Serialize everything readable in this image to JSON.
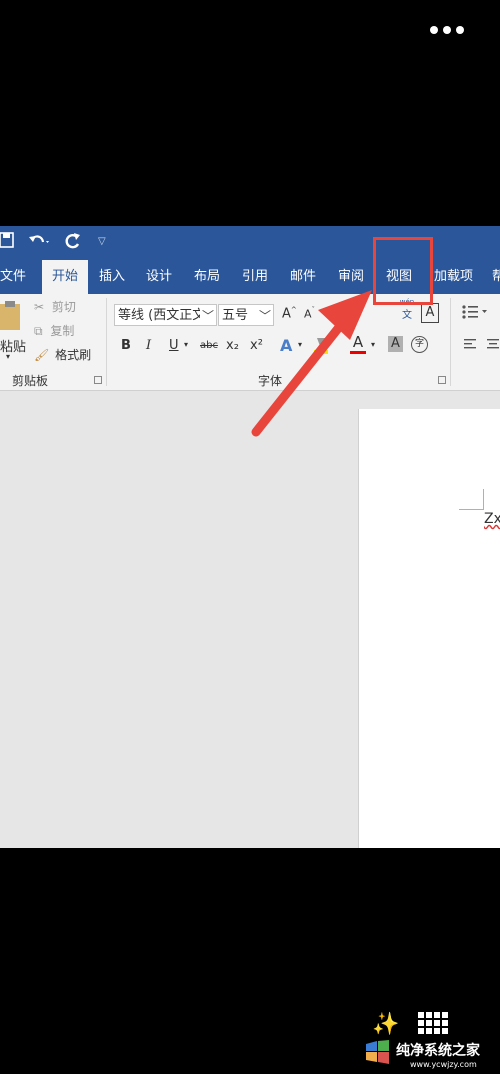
{
  "colors": {
    "ribbon_blue": "#2b579a",
    "annotation_red": "#e8453c"
  },
  "overlay": {
    "more_icon": "more-dots-icon"
  },
  "qat": {
    "save_icon": "save-icon",
    "undo_icon": "undo-icon",
    "redo_icon": "redo-icon",
    "customize_icon": "dropdown-caret-icon"
  },
  "tabs": {
    "file": "文件",
    "home": "开始",
    "insert": "插入",
    "design": "设计",
    "layout": "布局",
    "references": "引用",
    "mailings": "邮件",
    "review": "审阅",
    "view": "视图",
    "addins": "加载项",
    "help": "帮"
  },
  "clipboard": {
    "paste": "粘贴",
    "cut": "剪切",
    "copy": "复制",
    "format_painter": "格式刷",
    "label": "剪贴板"
  },
  "font": {
    "font_name": "等线 (西文正文",
    "font_size": "五号",
    "bold": "B",
    "italic": "I",
    "underline": "U",
    "strikethrough": "abc",
    "subscript": "x₂",
    "superscript": "x²",
    "grow": "A",
    "shrink": "A",
    "char_border": "A",
    "phonetic_top": "wén",
    "phonetic_bottom": "文",
    "label": "字体"
  },
  "document": {
    "text": "Zx"
  },
  "watermark": {
    "name": "纯净系统之家",
    "url": "www.ycwjzy.com"
  }
}
